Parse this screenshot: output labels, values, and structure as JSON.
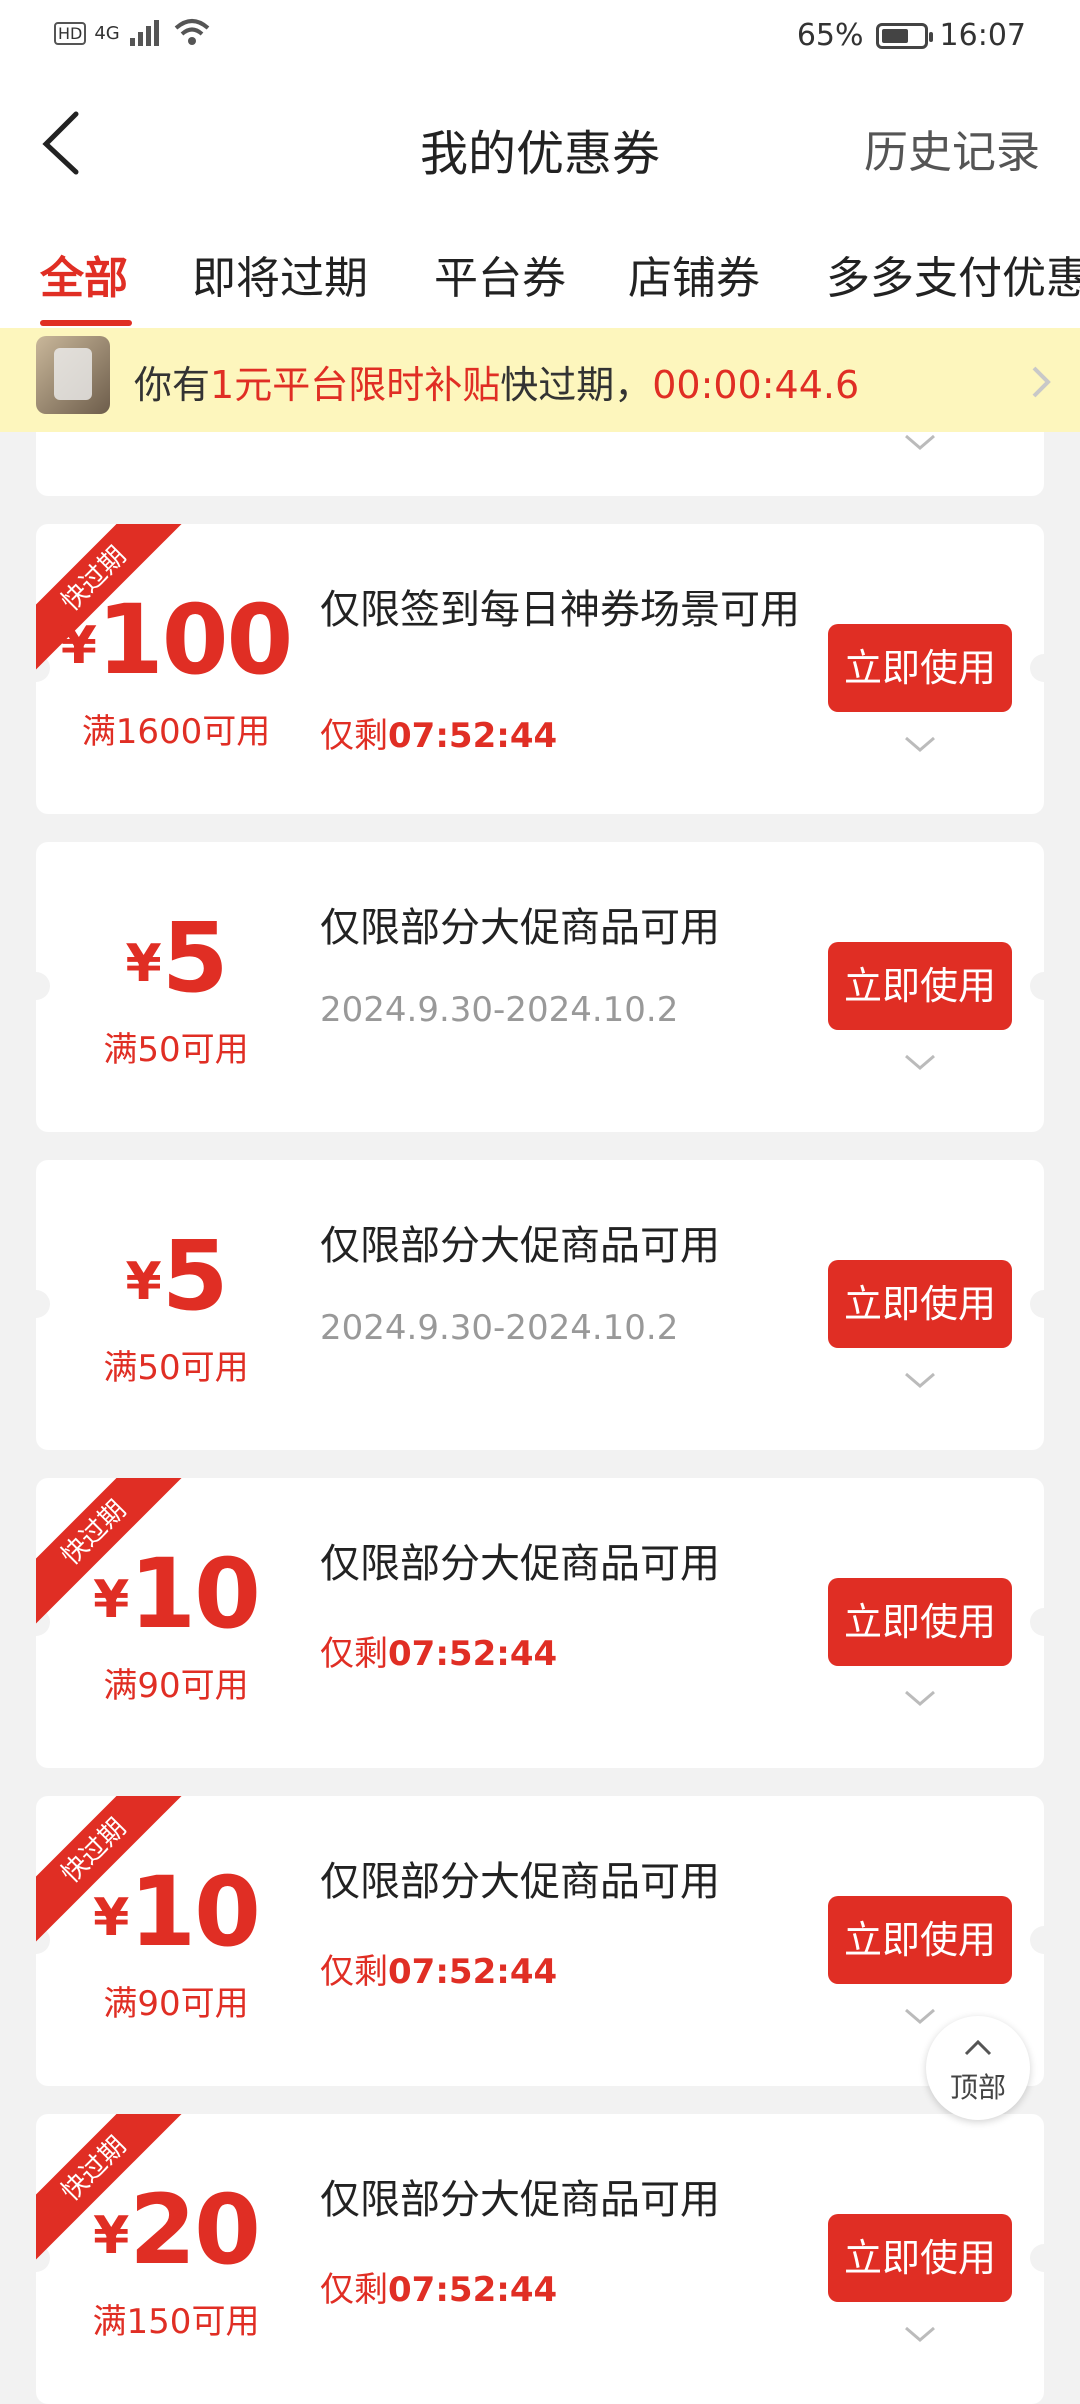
{
  "status": {
    "network": "4G",
    "battery": "65%",
    "battery_level": 0.65,
    "time": "16:07"
  },
  "header": {
    "title": "我的优惠券",
    "history": "历史记录"
  },
  "tabs": [
    "全部",
    "即将过期",
    "平台券",
    "店铺券",
    "多多支付优惠"
  ],
  "active_tab": 0,
  "notice": {
    "prefix": "你有",
    "highlight": "1元平台限时补贴",
    "middle": "快过期，",
    "countdown": "00:00:44.6"
  },
  "coupons": [
    {
      "ribbon": "快过期",
      "currency": "¥",
      "amount": "100",
      "condition": "满1600可用",
      "desc": "仅限签到每日神券场景可用",
      "sub_prefix": "仅剩",
      "sub_value": "07:52:44",
      "type": "countdown",
      "button": "立即使用"
    },
    {
      "ribbon": "",
      "currency": "¥",
      "amount": "5",
      "condition": "满50可用",
      "desc": "仅限部分大促商品可用",
      "sub_prefix": "",
      "sub_value": "2024.9.30-2024.10.2",
      "type": "date",
      "button": "立即使用"
    },
    {
      "ribbon": "",
      "currency": "¥",
      "amount": "5",
      "condition": "满50可用",
      "desc": "仅限部分大促商品可用",
      "sub_prefix": "",
      "sub_value": "2024.9.30-2024.10.2",
      "type": "date",
      "button": "立即使用"
    },
    {
      "ribbon": "快过期",
      "currency": "¥",
      "amount": "10",
      "condition": "满90可用",
      "desc": "仅限部分大促商品可用",
      "sub_prefix": "仅剩",
      "sub_value": "07:52:44",
      "type": "countdown",
      "button": "立即使用"
    },
    {
      "ribbon": "快过期",
      "currency": "¥",
      "amount": "10",
      "condition": "满90可用",
      "desc": "仅限部分大促商品可用",
      "sub_prefix": "仅剩",
      "sub_value": "07:52:44",
      "type": "countdown",
      "button": "立即使用"
    },
    {
      "ribbon": "快过期",
      "currency": "¥",
      "amount": "20",
      "condition": "满150可用",
      "desc": "仅限部分大促商品可用",
      "sub_prefix": "仅剩",
      "sub_value": "07:52:44",
      "type": "countdown",
      "button": "立即使用"
    }
  ],
  "top_button": "顶部"
}
